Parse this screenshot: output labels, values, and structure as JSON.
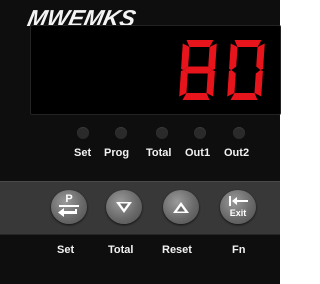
{
  "device": {
    "brand": "MWEMKS",
    "display_value": "80",
    "display_color": "#e8141c"
  },
  "indicators": [
    {
      "label": "Set"
    },
    {
      "label": "Prog"
    },
    {
      "label": "Total"
    },
    {
      "label": "Out1"
    },
    {
      "label": "Out2"
    }
  ],
  "keys": [
    {
      "label": "Set",
      "face_text": "P",
      "icon": "enter-arrow-icon"
    },
    {
      "label": "Total",
      "icon": "down-arrow-icon"
    },
    {
      "label": "Reset",
      "icon": "up-arrow-icon"
    },
    {
      "label": "Fn",
      "face_text": "Exit",
      "icon": "exit-arrow-icon"
    }
  ]
}
